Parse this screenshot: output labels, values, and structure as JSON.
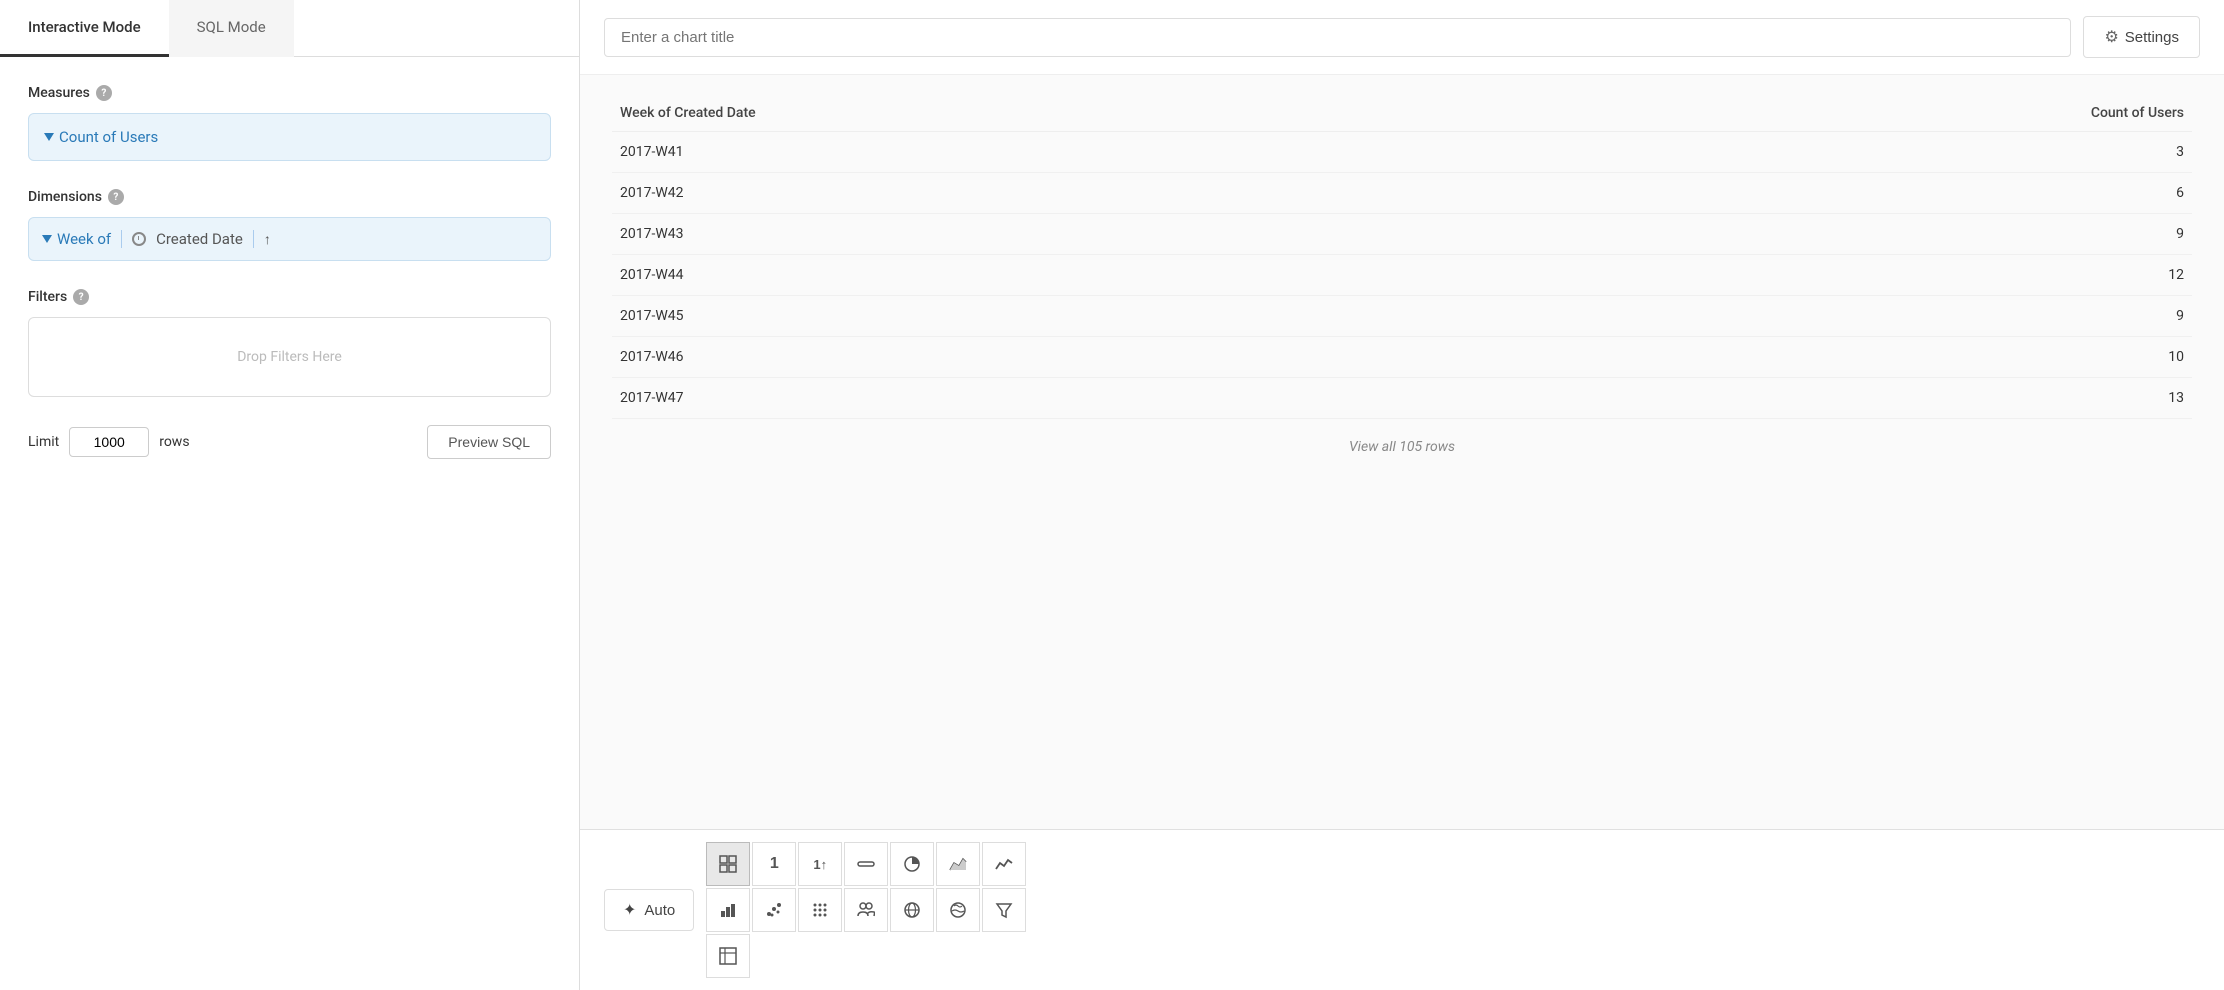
{
  "tabs": [
    {
      "label": "Interactive Mode",
      "active": true
    },
    {
      "label": "SQL Mode",
      "active": false
    }
  ],
  "measures": {
    "label": "Measures",
    "items": [
      {
        "label": "Count of Users"
      }
    ]
  },
  "dimensions": {
    "label": "Dimensions",
    "items": [
      {
        "prefix": "Week of",
        "field": "Created Date"
      }
    ]
  },
  "filters": {
    "label": "Filters",
    "placeholder": "Drop Filters Here"
  },
  "limit": {
    "label": "Limit",
    "value": "1000",
    "rows_label": "rows"
  },
  "preview_sql_btn": "Preview SQL",
  "chart": {
    "title_placeholder": "Enter a chart title",
    "settings_label": "Settings",
    "columns": [
      {
        "key": "week",
        "label": "Week of Created Date",
        "align": "left"
      },
      {
        "key": "count",
        "label": "Count of Users",
        "align": "right"
      }
    ],
    "rows": [
      {
        "week": "2017-W41",
        "count": "3"
      },
      {
        "week": "2017-W42",
        "count": "6"
      },
      {
        "week": "2017-W43",
        "count": "9"
      },
      {
        "week": "2017-W44",
        "count": "12"
      },
      {
        "week": "2017-W45",
        "count": "9"
      },
      {
        "week": "2017-W46",
        "count": "10"
      },
      {
        "week": "2017-W47",
        "count": "13"
      }
    ],
    "view_all_label": "View all 105 rows"
  },
  "toolbar": {
    "auto_label": "Auto",
    "viz_buttons": [
      {
        "icon": "⊞",
        "name": "table-viz",
        "active": true
      },
      {
        "icon": "1",
        "name": "number-viz",
        "active": false
      },
      {
        "icon": "1↑",
        "name": "trend-viz",
        "active": false
      },
      {
        "icon": "▬",
        "name": "progress-viz",
        "active": false
      },
      {
        "icon": "◕",
        "name": "pie-viz",
        "active": false
      },
      {
        "icon": "◤",
        "name": "area-viz",
        "active": false
      },
      {
        "icon": "〜",
        "name": "line-viz",
        "active": false
      },
      {
        "icon": "▐",
        "name": "bar-viz",
        "active": false
      },
      {
        "icon": "📈",
        "name": "combo-viz",
        "active": false
      },
      {
        "icon": "⊡",
        "name": "scatter-viz",
        "active": false
      },
      {
        "icon": "⁞",
        "name": "heatmap-viz",
        "active": false
      },
      {
        "icon": "⊙",
        "name": "globe-viz",
        "active": false
      },
      {
        "icon": "🌐",
        "name": "map-viz",
        "active": false
      },
      {
        "icon": "▽",
        "name": "filter-viz",
        "active": false
      },
      {
        "icon": "⊞",
        "name": "pivot-viz",
        "active": false
      }
    ]
  }
}
